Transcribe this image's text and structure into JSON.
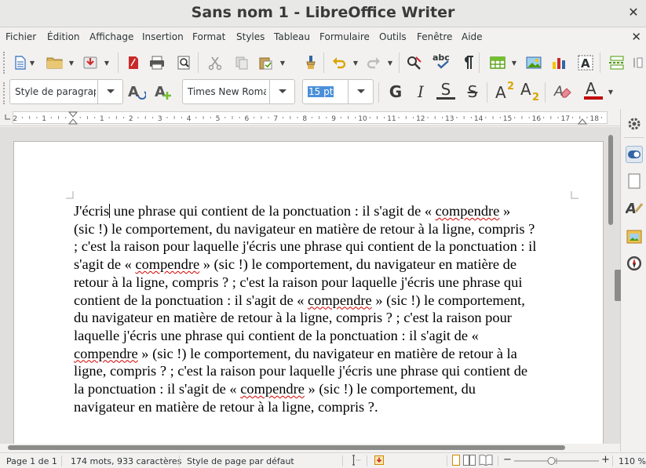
{
  "window": {
    "title": "Sans nom 1 - LibreOffice Writer",
    "close_glyph": "✕"
  },
  "menubar": {
    "items": [
      "Fichier",
      "Édition",
      "Affichage",
      "Insertion",
      "Format",
      "Styles",
      "Tableau",
      "Formulaire",
      "Outils",
      "Fenêtre",
      "Aide"
    ],
    "close_glyph": "✕"
  },
  "toolbar2": {
    "paragraph_style": "Style de paragraphe",
    "font_name": "Times New Roman",
    "font_size": "15 pt",
    "bold_label": "G",
    "italic_label": "I",
    "underline_label": "S",
    "strike_label": "S"
  },
  "ruler": {
    "labels": [
      "1",
      "2",
      "1",
      "2",
      "3",
      "4",
      "5",
      "6",
      "7",
      "8",
      "9",
      "10",
      "11",
      "12",
      "13",
      "14",
      "15",
      "16",
      "17",
      "18"
    ]
  },
  "document": {
    "lines": [
      [
        {
          "t": "J'écris"
        },
        {
          "cursor": true
        },
        {
          "t": " une phrase qui contient de la ponctuation : il s'agit de « "
        },
        {
          "t": "compendre",
          "sq": true
        },
        {
          "t": " »"
        }
      ],
      [
        {
          "t": "(sic !) le comportement, du navigateur en matière de retour à la ligne, compris ?"
        }
      ],
      [
        {
          "t": "; c'est la raison pour laquelle j'écris une phrase qui contient de la ponctuation : il"
        }
      ],
      [
        {
          "t": "s'agit de « "
        },
        {
          "t": "compendre",
          "sq": true
        },
        {
          "t": " » (sic !) le comportement, du navigateur en matière de"
        }
      ],
      [
        {
          "t": "retour à la ligne, compris ? ; c'est la raison pour laquelle j'écris une phrase qui"
        }
      ],
      [
        {
          "t": "contient de la ponctuation : il s'agit de « "
        },
        {
          "t": "compendre",
          "sq": true
        },
        {
          "t": " » (sic !) le comportement,"
        }
      ],
      [
        {
          "t": "du navigateur en matière de retour à la ligne, compris ? ; c'est la raison pour"
        }
      ],
      [
        {
          "t": "laquelle j'écris une phrase qui contient de la ponctuation : il s'agit de «"
        }
      ],
      [
        {
          "t": "compendre",
          "sq": true
        },
        {
          "t": " » (sic !) le comportement, du navigateur en matière de retour à la"
        }
      ],
      [
        {
          "t": "ligne, compris ? ; c'est la raison pour laquelle j'écris une phrase qui contient de"
        }
      ],
      [
        {
          "t": "la ponctuation : il s'agit de « "
        },
        {
          "t": "compendre",
          "sq": true
        },
        {
          "t": " » (sic !) le comportement, du"
        }
      ],
      [
        {
          "t": "navigateur en matière de retour à la ligne, compris ?."
        }
      ]
    ]
  },
  "statusbar": {
    "page": "Page 1 de 1",
    "word_count": "174 mots, 933 caractères",
    "page_style": "Style de page par défaut",
    "zoom_percent": "110 %",
    "zoom_level": 0.44
  },
  "colors": {
    "accent": "#4a90d9",
    "spell_error": "#d50000",
    "font_color": "#c00000",
    "highlight": "#f5c400"
  }
}
